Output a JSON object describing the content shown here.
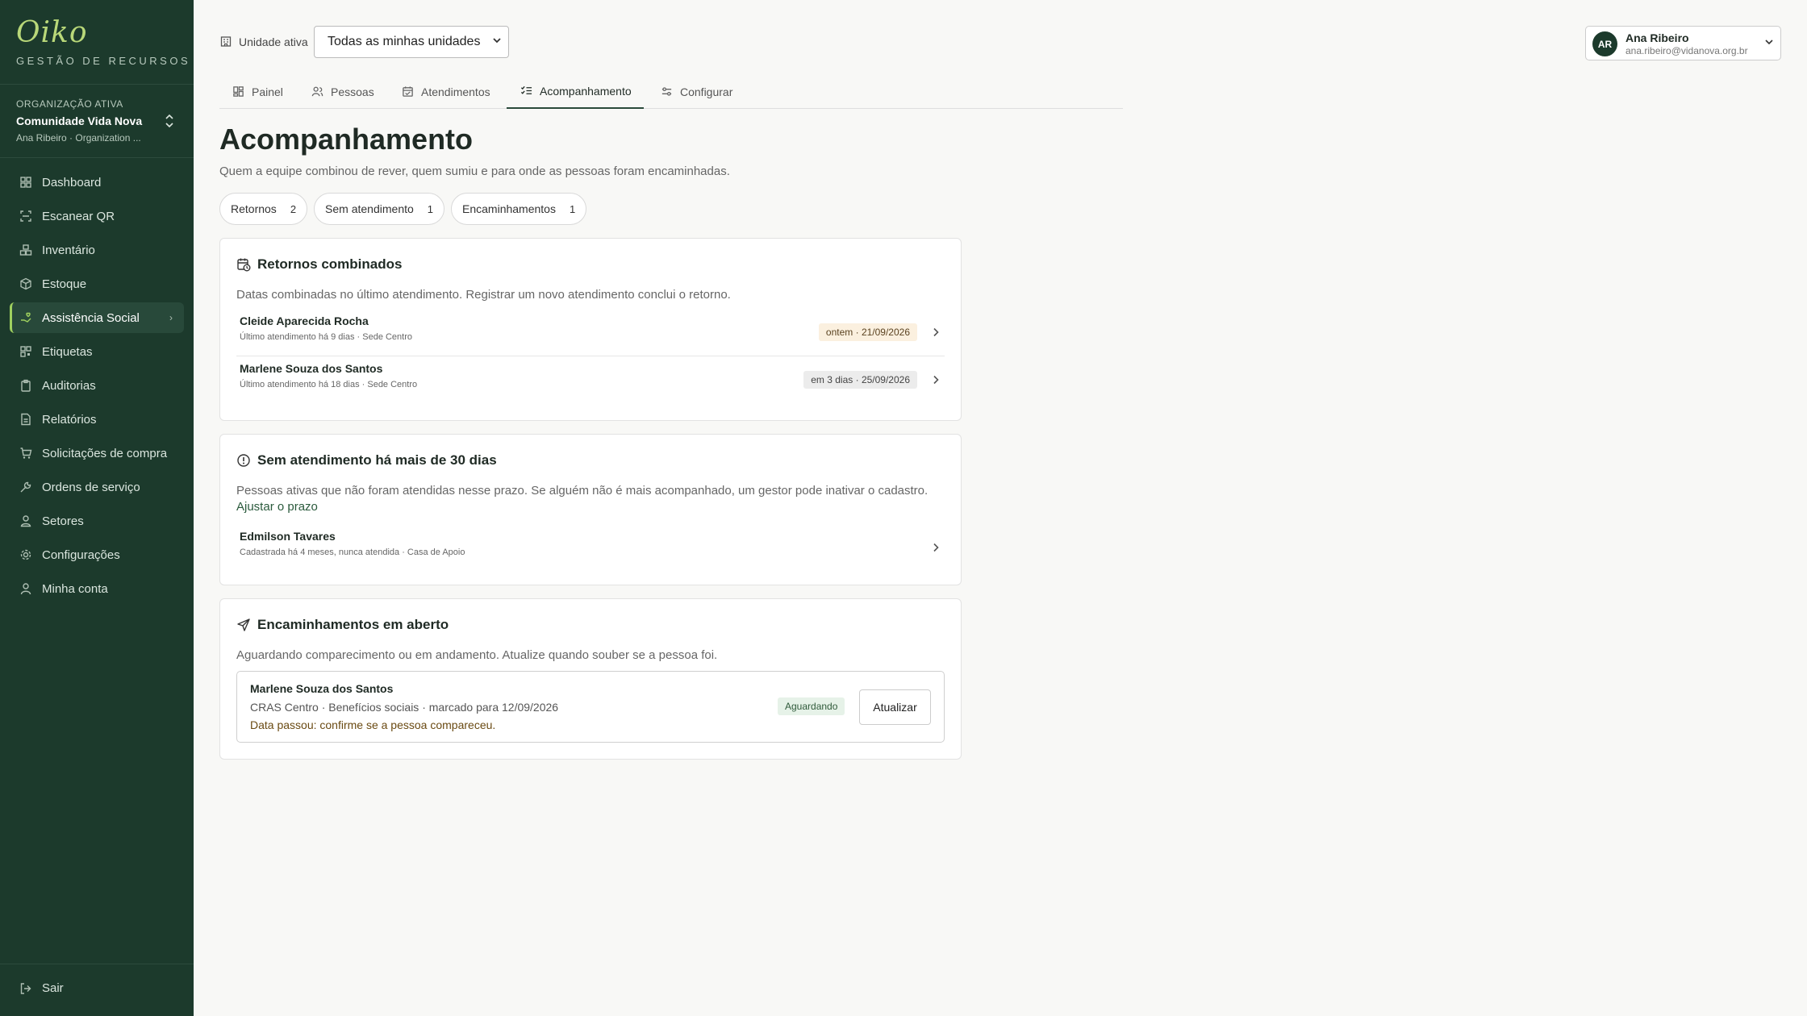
{
  "brand": {
    "logo": "Oiko",
    "subtitle": "GESTÃO DE RECURSOS"
  },
  "organization": {
    "label": "ORGANIZAÇÃO ATIVA",
    "name": "Comunidade Vida Nova",
    "user_line": "Ana Ribeiro · Organization ..."
  },
  "sidebar": {
    "items": [
      {
        "label": "Dashboard",
        "icon": "grid-icon"
      },
      {
        "label": "Escanear QR",
        "icon": "scan-icon"
      },
      {
        "label": "Inventário",
        "icon": "boxes-icon"
      },
      {
        "label": "Estoque",
        "icon": "package-icon"
      },
      {
        "label": "Assistência Social",
        "icon": "hand-heart-icon",
        "active": true
      },
      {
        "label": "Etiquetas",
        "icon": "qr-icon"
      },
      {
        "label": "Auditorias",
        "icon": "clipboard-icon"
      },
      {
        "label": "Relatórios",
        "icon": "file-icon"
      },
      {
        "label": "Solicitações de compra",
        "icon": "cart-icon"
      },
      {
        "label": "Ordens de serviço",
        "icon": "wrench-icon"
      },
      {
        "label": "Setores",
        "icon": "user-group-icon"
      },
      {
        "label": "Configurações",
        "icon": "gear-icon"
      },
      {
        "label": "Minha conta",
        "icon": "user-icon"
      }
    ],
    "logout": "Sair",
    "accent": "#9fd05f",
    "background": "#1c3a2c"
  },
  "topbar": {
    "unit_label": "Unidade ativa",
    "unit_value": "Todas as minhas unidades",
    "user": {
      "initials": "AR",
      "name": "Ana Ribeiro",
      "email": "ana.ribeiro@vidanova.org.br"
    }
  },
  "tabs": [
    {
      "label": "Painel",
      "icon": "layout-icon"
    },
    {
      "label": "Pessoas",
      "icon": "users-icon"
    },
    {
      "label": "Atendimentos",
      "icon": "calendar-icon"
    },
    {
      "label": "Acompanhamento",
      "icon": "list-check-icon",
      "active": true
    },
    {
      "label": "Configurar",
      "icon": "sliders-icon"
    }
  ],
  "page": {
    "title": "Acompanhamento",
    "subtitle": "Quem a equipe combinou de rever, quem sumiu e para onde as pessoas foram encaminhadas."
  },
  "chips": [
    {
      "label": "Retornos",
      "count": "2"
    },
    {
      "label": "Sem atendimento",
      "count": "1"
    },
    {
      "label": "Encaminhamentos",
      "count": "1"
    }
  ],
  "returns": {
    "title": "Retornos combinados",
    "description": "Datas combinadas no último atendimento. Registrar um novo atendimento conclui o retorno.",
    "rows": [
      {
        "name": "Cleide Aparecida Rocha",
        "meta": "Último atendimento há 9 dias · Sede Centro",
        "badge": "ontem · 21/09/2026"
      },
      {
        "name": "Marlene Souza dos Santos",
        "meta": "Último atendimento há 18 dias · Sede Centro",
        "badge": "em 3 dias · 25/09/2026"
      }
    ]
  },
  "inactive": {
    "title": "Sem atendimento há mais de 30 dias",
    "description": "Pessoas ativas que não foram atendidas nesse prazo. Se alguém não é mais acompanhado, um gestor pode inativar o cadastro.",
    "link": "Ajustar o prazo",
    "rows": [
      {
        "name": "Edmilson Tavares",
        "meta": "Cadastrada há 4 meses, nunca atendida · Casa de Apoio"
      }
    ]
  },
  "referrals": {
    "title": "Encaminhamentos em aberto",
    "description": "Aguardando comparecimento ou em andamento. Atualize quando souber se a pessoa foi.",
    "items": [
      {
        "name": "Marlene Souza dos Santos",
        "meta": "CRAS Centro · Benefícios sociais · marcado para 12/09/2026",
        "note": "Data passou: confirme se a pessoa compareceu.",
        "status": "Aguardando",
        "action": "Atualizar"
      }
    ]
  }
}
